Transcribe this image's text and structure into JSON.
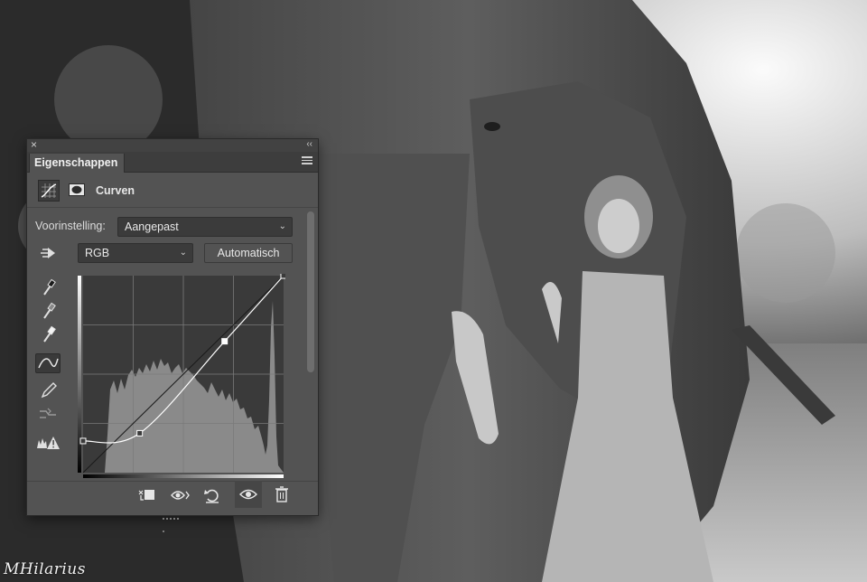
{
  "panel": {
    "tab_label": "Eigenschappen",
    "title": "Curven",
    "preset_label": "Voorinstelling:",
    "preset_value": "Aangepast",
    "channel_value": "RGB",
    "auto_button_label": "Automatisch",
    "close_glyph": "×",
    "collapse_glyph": "‹‹",
    "dropdown_chevron": "⌄"
  },
  "tools": [
    {
      "name": "on-image-adjust-icon",
      "selected": false
    },
    {
      "name": "black-point-eyedropper-icon",
      "selected": false
    },
    {
      "name": "gray-point-eyedropper-icon",
      "selected": false
    },
    {
      "name": "white-point-eyedropper-icon",
      "selected": false
    },
    {
      "name": "curve-points-icon",
      "selected": true
    },
    {
      "name": "pencil-draw-icon",
      "selected": false
    },
    {
      "name": "smooth-curve-icon",
      "selected": false
    },
    {
      "name": "clipping-warning-icon",
      "selected": false
    }
  ],
  "bottom_bar": [
    "clip-to-layer-icon",
    "view-previous-state-icon",
    "reset-icon",
    "visibility-eye-icon",
    "delete-icon"
  ],
  "curve": {
    "input_range": [
      0,
      255
    ],
    "output_range": [
      0,
      255
    ],
    "points": [
      [
        0,
        41
      ],
      [
        72,
        51
      ],
      [
        180,
        170
      ],
      [
        255,
        255
      ]
    ],
    "graph_background": "#3a3a3a",
    "histogram_color": "#8a8a8a",
    "curve_color": "#ffffff"
  },
  "signature": "MHilarius",
  "colors": {
    "panel_bg": "#535353",
    "titlebar_bg": "#424242",
    "control_bg": "#3b3b3b"
  }
}
